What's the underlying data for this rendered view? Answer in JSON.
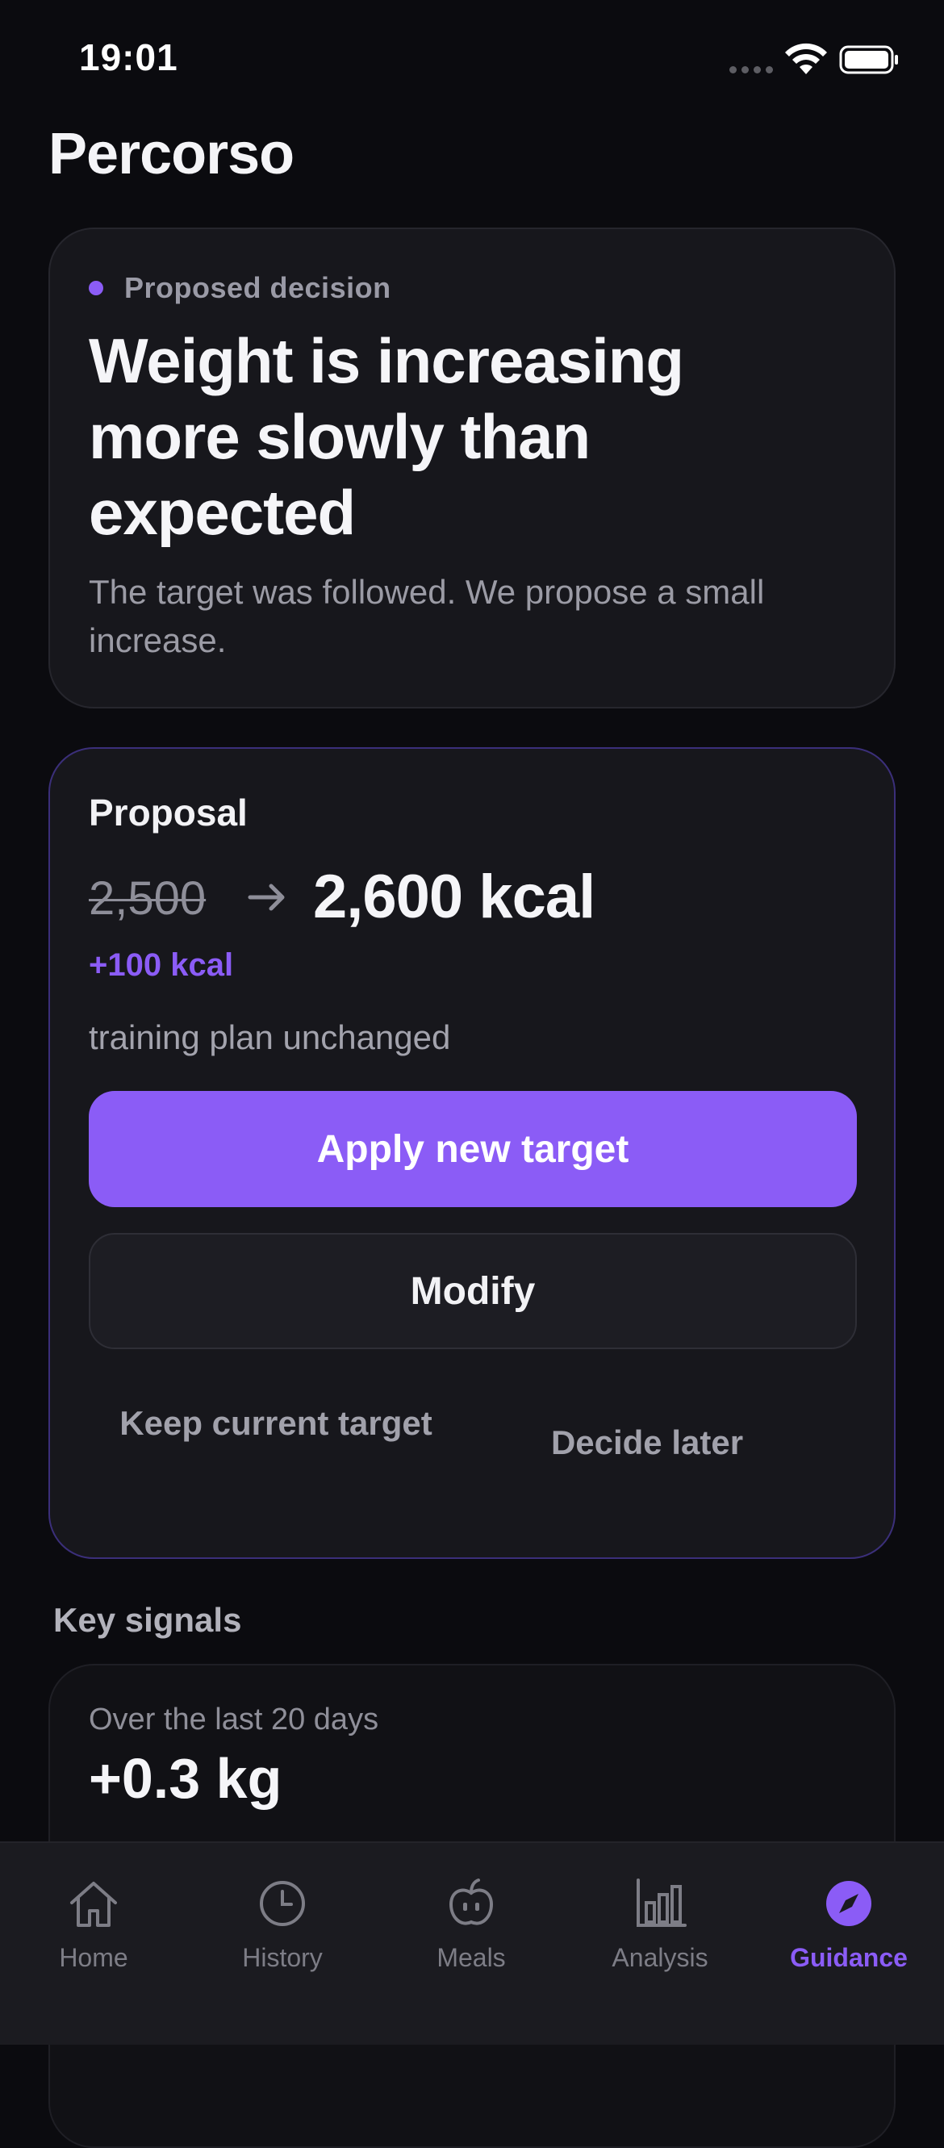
{
  "status_bar": {
    "time": "19:01"
  },
  "page": {
    "title": "Percorso"
  },
  "decision": {
    "label": "Proposed decision",
    "headline": "Weight is increasing more slowly than expected",
    "subtext": "The target was followed. We propose a small increase."
  },
  "proposal": {
    "title": "Proposal",
    "old_target": "2,500",
    "new_target": "2,600 kcal",
    "delta": "+100 kcal",
    "note": "training plan unchanged",
    "apply_label": "Apply new target",
    "modify_label": "Modify",
    "keep_label": "Keep current target",
    "later_label": "Decide later"
  },
  "signals": {
    "heading": "Key signals",
    "caption": "Over the last 20 days",
    "value": "+0.3 kg"
  },
  "tabs": [
    {
      "label": "Home",
      "icon": "home-icon",
      "active": false
    },
    {
      "label": "History",
      "icon": "clock-icon",
      "active": false
    },
    {
      "label": "Meals",
      "icon": "apple-icon",
      "active": false
    },
    {
      "label": "Analysis",
      "icon": "bar-chart-icon",
      "active": false
    },
    {
      "label": "Guidance",
      "icon": "compass-icon",
      "active": true
    }
  ],
  "colors": {
    "accent": "#8b5cf6",
    "background": "#0b0b0f",
    "card": "#17171c"
  }
}
